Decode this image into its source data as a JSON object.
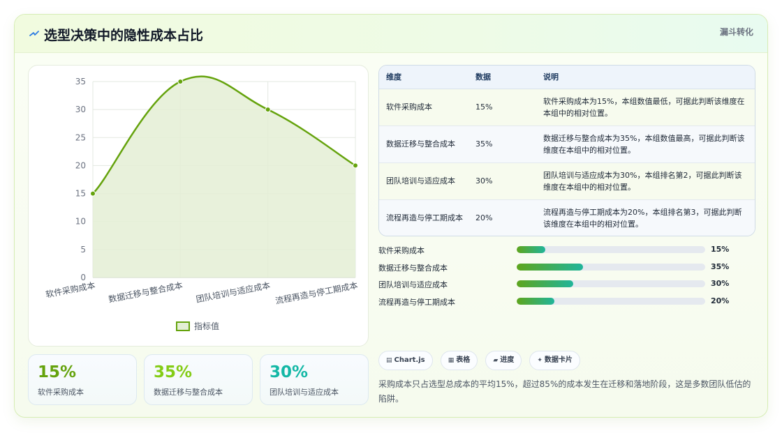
{
  "header": {
    "title": "选型决策中的隐性成本占比",
    "badge": "漏斗转化",
    "title_icon": "lightning-icon"
  },
  "chart_data": {
    "type": "area",
    "categories": [
      "软件采购成本",
      "数据迁移与整合成本",
      "团队培训与适应成本",
      "流程再造与停工期成本"
    ],
    "series": [
      {
        "name": "指标值",
        "values": [
          15,
          35,
          30,
          20
        ]
      }
    ],
    "y_ticks": [
      "0",
      "5",
      "10",
      "15",
      "20",
      "25",
      "30",
      "35"
    ],
    "ylim": [
      0,
      35
    ],
    "grid": true,
    "legend_position": "bottom",
    "colors": {
      "line": "#65a30d",
      "fill": "#e4efd5"
    }
  },
  "stats": [
    {
      "value": "15%",
      "label": "软件采购成本",
      "color": "#65a30d"
    },
    {
      "value": "35%",
      "label": "数据迁移与整合成本",
      "color": "#84cc16"
    },
    {
      "value": "30%",
      "label": "团队培训与适应成本",
      "color": "#14b8a6"
    }
  ],
  "table": {
    "headers": [
      "维度",
      "数据",
      "说明"
    ],
    "rows": [
      [
        "软件采购成本",
        "15%",
        "软件采购成本为15%，本组数值最低，可据此判断该维度在本组中的相对位置。"
      ],
      [
        "数据迁移与整合成本",
        "35%",
        "数据迁移与整合成本为35%，本组数值最高，可据此判断该维度在本组中的相对位置。"
      ],
      [
        "团队培训与适应成本",
        "30%",
        "团队培训与适应成本为30%，本组排名第2，可据此判断该维度在本组中的相对位置。"
      ],
      [
        "流程再造与停工期成本",
        "20%",
        "流程再造与停工期成本为20%，本组排名第3，可据此判断该维度在本组中的相对位置。"
      ]
    ]
  },
  "progress": [
    {
      "label": "软件采购成本",
      "value_text": "15%",
      "fraction": 0.15
    },
    {
      "label": "数据迁移与整合成本",
      "value_text": "35%",
      "fraction": 0.35
    },
    {
      "label": "团队培训与适应成本",
      "value_text": "30%",
      "fraction": 0.3
    },
    {
      "label": "流程再造与停工期成本",
      "value_text": "20%",
      "fraction": 0.2
    }
  ],
  "tags": [
    {
      "icon": "chart-icon",
      "glyph": "▤",
      "label": "Chart.js"
    },
    {
      "icon": "table-icon",
      "glyph": "▦",
      "label": "表格"
    },
    {
      "icon": "progress-icon",
      "glyph": "▰",
      "label": "进度"
    },
    {
      "icon": "sparkle-icon",
      "glyph": "✦",
      "label": "数据卡片"
    }
  ],
  "summary": "采购成本只占选型总成本的平均15%，超过85%的成本发生在迁移和落地阶段，这是多数团队低估的陷阱。"
}
